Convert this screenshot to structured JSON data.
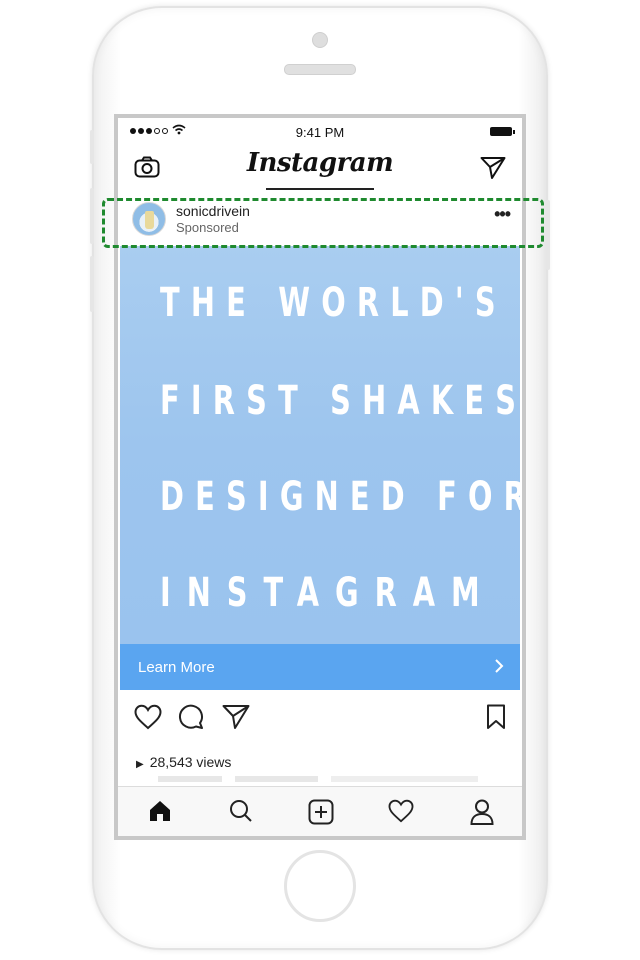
{
  "status_bar": {
    "time": "9:41 PM"
  },
  "nav": {
    "logo_text": "Instagram",
    "left_icon": "camera-icon",
    "right_icon": "direct-send-icon"
  },
  "post": {
    "username": "sonicdrivein",
    "sponsored_label": "Sponsored",
    "more_icon": "more-dots-icon",
    "more_label": "•••",
    "ad_lines": [
      "THE WORLD'S",
      "FIRST SHAKES",
      "DESIGNED FOR",
      "INSTAGRAM"
    ],
    "cta_label": "Learn More",
    "cta_icon": "chevron-right-icon",
    "views_text": "28,543 views",
    "views_icon": "play-triangle-icon"
  },
  "actions": [
    "heart-icon",
    "comment-icon",
    "share-icon",
    "bookmark-icon"
  ],
  "tab_bar": [
    "home-icon",
    "search-icon",
    "add-post-icon",
    "activity-heart-icon",
    "profile-icon"
  ],
  "colors": {
    "cta_blue": "#5aa5f0",
    "ad_background": "#a9cdf0",
    "highlight_green": "#1f8a2f"
  }
}
